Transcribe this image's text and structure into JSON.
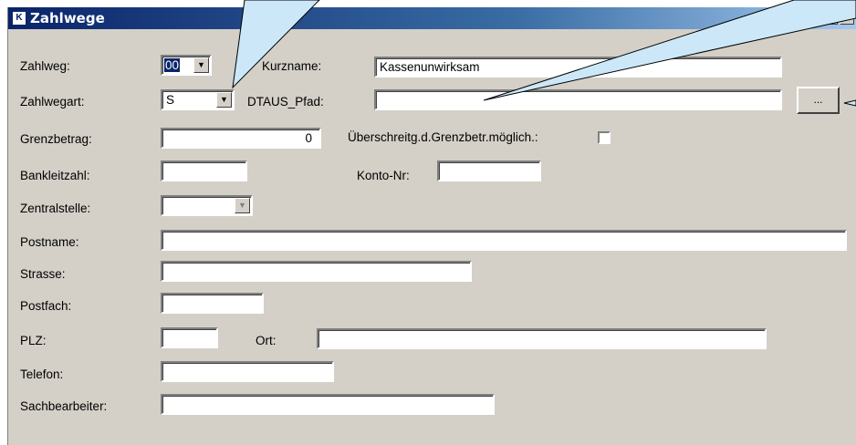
{
  "window": {
    "title": "Zahlwege",
    "icon": "app-icon",
    "icon_glyph": "K"
  },
  "form": {
    "zahlweg": {
      "label": "Zahlweg:",
      "value": "00"
    },
    "kurzname": {
      "label": "Kurzname:",
      "value": "Kassenunwirksam"
    },
    "zahlwegart": {
      "label": "Zahlwegart:",
      "value": "S"
    },
    "dtaus_pfad": {
      "label": "DTAUS_Pfad:",
      "value": ""
    },
    "browse_button": {
      "label": "..."
    },
    "grenzbetrag": {
      "label": "Grenzbetrag:",
      "value": "0"
    },
    "ueberschreitung": {
      "label": "Überschreitg.d.Grenzbetr.möglich.:",
      "checked": false
    },
    "bankleitzahl": {
      "label": "Bankleitzahl:",
      "value": ""
    },
    "konto_nr": {
      "label": "Konto-Nr:",
      "value": ""
    },
    "zentralstelle": {
      "label": "Zentralstelle:",
      "value": ""
    },
    "postname": {
      "label": "Postname:",
      "value": ""
    },
    "strasse": {
      "label": "Strasse:",
      "value": ""
    },
    "postfach": {
      "label": "Postfach:",
      "value": ""
    },
    "plz": {
      "label": "PLZ:",
      "value": ""
    },
    "ort": {
      "label": "Ort:",
      "value": ""
    },
    "telefon": {
      "label": "Telefon:",
      "value": ""
    },
    "sachbearbeiter": {
      "label": "Sachbearbeiter:",
      "value": ""
    }
  },
  "colors": {
    "callout_fill": "#cce8f8",
    "callout_stroke": "#000000",
    "window_bg": "#d4d0c8",
    "title_bar": "#0a246a"
  }
}
